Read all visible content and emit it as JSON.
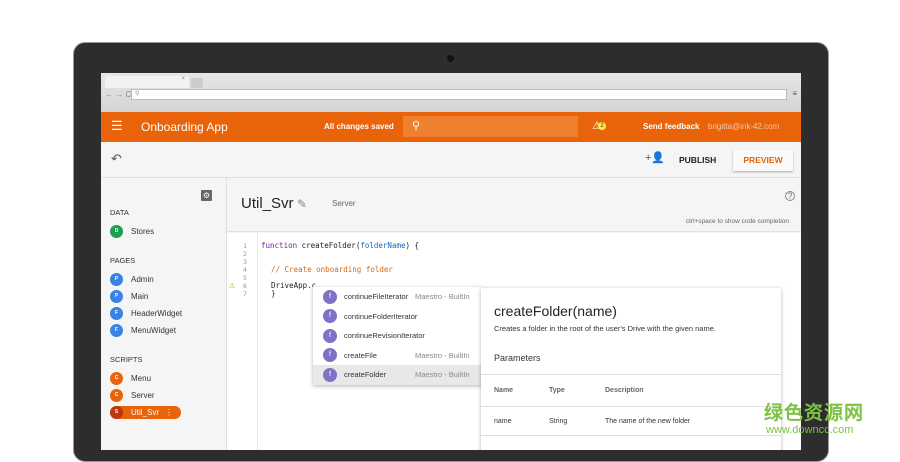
{
  "browser": {
    "tab_close": "×",
    "nav": "← → C",
    "search_icon": "search-icon",
    "menu": "≡"
  },
  "appbar": {
    "title": "Onboarding App",
    "status": "All changes saved",
    "warning_count": "2",
    "feedback": "Send feedback",
    "user": "brigitta@ink-42.com",
    "color": "#e8630a"
  },
  "toolbar": {
    "publish": "PUBLISH",
    "preview": "PREVIEW"
  },
  "sidebar": {
    "sections": [
      {
        "title": "DATA",
        "items": [
          {
            "badge": "D",
            "label": "Stores",
            "color": "#1e9e50"
          }
        ]
      },
      {
        "title": "PAGES",
        "items": [
          {
            "badge": "P",
            "label": "Admin",
            "color": "#3b82e6"
          },
          {
            "badge": "P",
            "label": "Main",
            "color": "#3b82e6"
          },
          {
            "badge": "F",
            "label": "HeaderWidget",
            "color": "#3b82e6"
          },
          {
            "badge": "F",
            "label": "MenuWidget",
            "color": "#3b82e6"
          }
        ]
      },
      {
        "title": "SCRIPTS",
        "items": [
          {
            "badge": "C",
            "label": "Menu",
            "color": "#e8630a"
          },
          {
            "badge": "C",
            "label": "Server",
            "color": "#e8630a"
          },
          {
            "badge": "S",
            "label": "Util_Svr",
            "color": "#e8630a",
            "active": true
          }
        ]
      }
    ]
  },
  "editor": {
    "file_name": "Util_Svr",
    "file_type": "Server",
    "hint": "ctrl+space to show code completion",
    "help": "?",
    "line_numbers": [
      "1",
      "2",
      "3",
      "4",
      "5",
      "6",
      "7"
    ],
    "code": {
      "kw": "function",
      "fn": " createFolder(",
      "param": "folderName",
      "end": ") {",
      "comment": "// Create onboarding folder",
      "line6": "DriveApp.c",
      "line7": "}"
    }
  },
  "autocomplete": {
    "items": [
      {
        "icon": "f",
        "name": "continueFileIterator",
        "source": "Maestro - BuiltIn"
      },
      {
        "icon": "f",
        "name": "continueFolderIterator",
        "source": ""
      },
      {
        "icon": "f",
        "name": "continueRevisionIterator",
        "source": ""
      },
      {
        "icon": "f",
        "name": "createFile",
        "source": "Maestro - BuiltIn"
      },
      {
        "icon": "f",
        "name": "createFolder",
        "source": "Maestro - BuiltIn",
        "selected": true
      }
    ]
  },
  "doc": {
    "title": "createFolder(name)",
    "description": "Creates a folder in the root of the user's Drive with the given name.",
    "params_title": "Parameters",
    "headers": [
      "Name",
      "Type",
      "Description"
    ],
    "rows": [
      [
        "name",
        "String",
        "The name of the new folder"
      ]
    ]
  },
  "watermark": {
    "text": "绿色资源网",
    "url": "www.downcc.com"
  }
}
